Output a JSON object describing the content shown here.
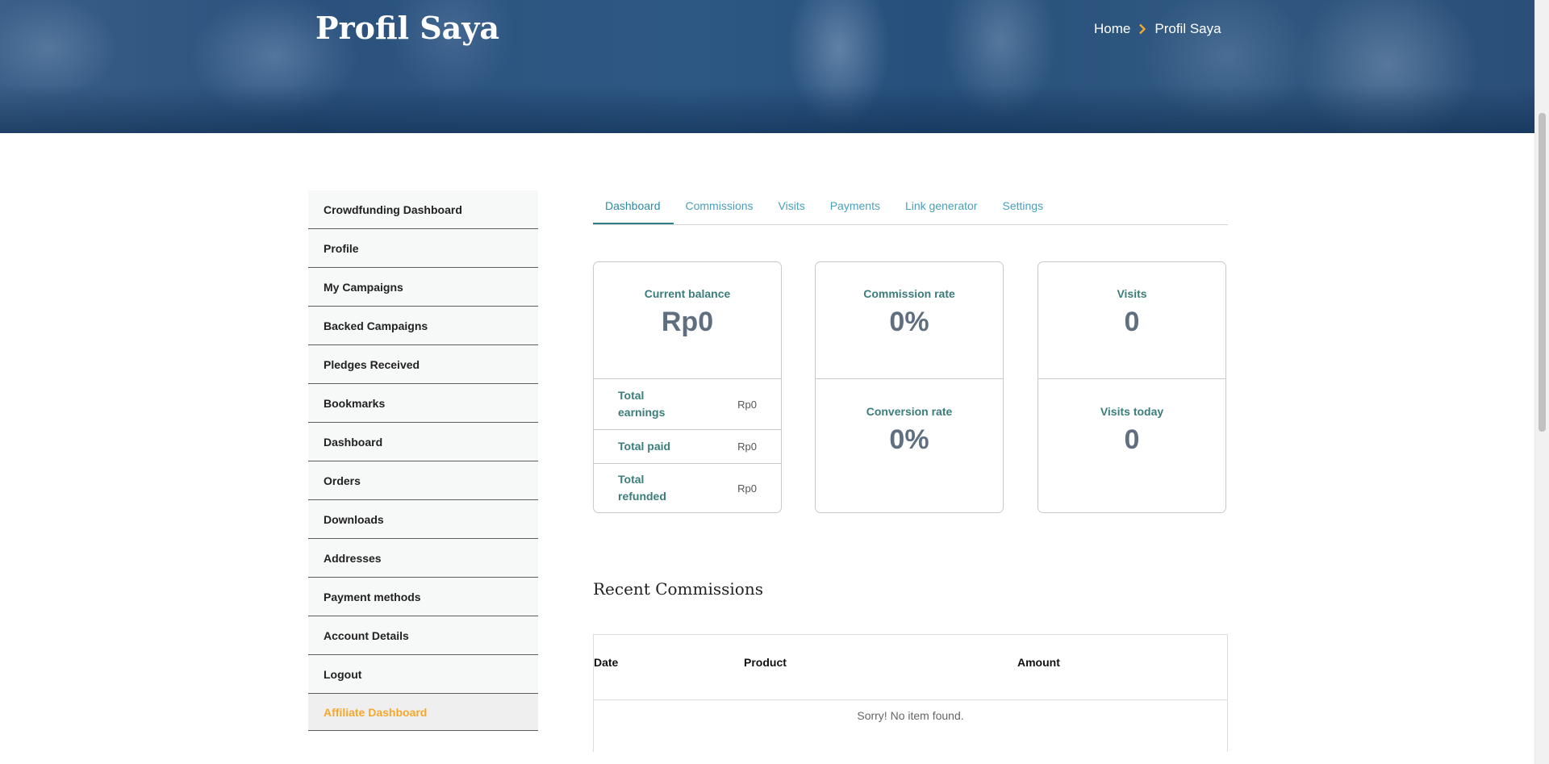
{
  "header": {
    "title": "Profil Saya",
    "breadcrumb": {
      "home": "Home",
      "current": "Profil Saya"
    }
  },
  "sidebar": {
    "items": [
      {
        "label": "Crowdfunding Dashboard"
      },
      {
        "label": "Profile"
      },
      {
        "label": "My Campaigns"
      },
      {
        "label": "Backed Campaigns"
      },
      {
        "label": "Pledges Received"
      },
      {
        "label": "Bookmarks"
      },
      {
        "label": "Dashboard"
      },
      {
        "label": "Orders"
      },
      {
        "label": "Downloads"
      },
      {
        "label": "Addresses"
      },
      {
        "label": "Payment methods"
      },
      {
        "label": "Account Details"
      },
      {
        "label": "Logout"
      },
      {
        "label": "Affiliate Dashboard",
        "active": true
      }
    ],
    "active_color": "#f6a82c"
  },
  "tabs": [
    {
      "label": "Dashboard",
      "active": true
    },
    {
      "label": "Commissions"
    },
    {
      "label": "Visits"
    },
    {
      "label": "Payments"
    },
    {
      "label": "Link generator"
    },
    {
      "label": "Settings"
    }
  ],
  "stats": {
    "balance": {
      "label": "Current balance",
      "value": "Rp0",
      "rows": [
        {
          "label": "Total earnings",
          "value": "Rp0"
        },
        {
          "label": "Total paid",
          "value": "Rp0"
        },
        {
          "label": "Total refunded",
          "value": "Rp0"
        }
      ]
    },
    "commission": {
      "label": "Commission rate",
      "value": "0%",
      "sub_label": "Conversion rate",
      "sub_value": "0%"
    },
    "visits": {
      "label": "Visits",
      "value": "0",
      "sub_label": "Visits today",
      "sub_value": "0"
    }
  },
  "recent": {
    "title": "Recent Commissions",
    "columns": [
      "Date",
      "Product",
      "Amount"
    ],
    "empty_message": "Sorry! No item found."
  },
  "colors": {
    "accent": "#3b7d7a",
    "tab_text": "#4aa0b8",
    "value_text": "#5f6f7f",
    "breadcrumb_chevron": "#f6a82c"
  },
  "icons": {
    "breadcrumb_separator": "chevron-right-icon"
  }
}
